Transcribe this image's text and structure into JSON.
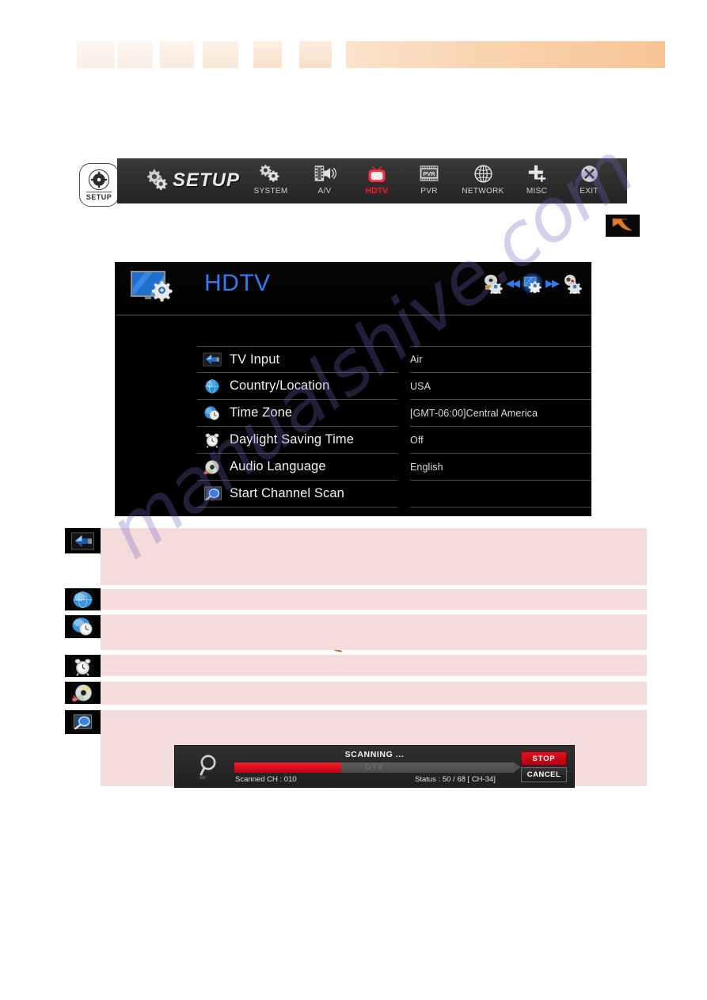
{
  "top_band": {
    "redacted_words": [
      "",
      "",
      "",
      "",
      "",
      ""
    ],
    "redacted_bar": ""
  },
  "setup_badge": {
    "label": "SETUP",
    "icon": "gear-icon"
  },
  "menubar": {
    "brand_label": "SETUP",
    "brand_icon": "double-gear-icon",
    "items": [
      {
        "label": "SYSTEM",
        "icon": "double-gear-icon",
        "active": false
      },
      {
        "label": "A/V",
        "icon": "film-speaker-icon",
        "active": false
      },
      {
        "label": "HDTV",
        "icon": "television-icon",
        "active": true
      },
      {
        "label": "PVR",
        "icon": "film-pvr-icon",
        "active": false
      },
      {
        "label": "NETWORK",
        "icon": "globe-icon",
        "active": false
      },
      {
        "label": "MISC",
        "icon": "plus-icon",
        "active": false
      },
      {
        "label": "EXIT",
        "icon": "close-x-icon",
        "active": false
      }
    ],
    "active_color": "#ff2b3c",
    "background": "#2e2e2e"
  },
  "cursor": {
    "icon": "orange-curved-arrow-icon",
    "color": "#e07b2e"
  },
  "panel": {
    "title": "HDTV",
    "title_color": "#2f7cf6",
    "icon": "monitor-gear-icon",
    "nav": {
      "prev_icon": "prev-chevrons-icon",
      "next_icon": "next-chevrons-icon",
      "left_icon": "disc-gear-icon",
      "center_icon": "monitor-gear-icon",
      "right_icon": "camera-gear-icon"
    },
    "settings": [
      {
        "icon": "tv-input-arrow-icon",
        "label": "TV Input",
        "value": "Air"
      },
      {
        "icon": "globe-icon",
        "label": "Country/Location",
        "value": "USA"
      },
      {
        "icon": "globe-clock-icon",
        "label": "Time Zone",
        "value": "[GMT-06:00]Central America"
      },
      {
        "icon": "alarm-clock-icon",
        "label": "Daylight Saving Time",
        "value": "Off"
      },
      {
        "icon": "audio-disc-icon",
        "label": "Audio Language",
        "value": "English"
      },
      {
        "icon": "scan-magnifier-icon",
        "label": "Start Channel Scan",
        "value": ""
      }
    ]
  },
  "descriptions": [
    {
      "icon": "tv-input-arrow-icon",
      "text": ""
    },
    {
      "icon": "globe-icon",
      "text": ""
    },
    {
      "icon": "globe-clock-icon",
      "text": ""
    },
    {
      "icon": "alarm-clock-icon",
      "text": ""
    },
    {
      "icon": "audio-disc-icon",
      "text": ""
    },
    {
      "icon": "scan-magnifier-icon",
      "text": ""
    }
  ],
  "scan_dialog": {
    "icon": "magnifier-icon",
    "title": "SCANNING ...",
    "bar_label": "DTV",
    "progress_percent": 38,
    "scanned_text": "Scanned CH : 010",
    "status_text": "Status : 50 / 68 [ CH-34]",
    "stop_label": "STOP",
    "cancel_label": "CANCEL",
    "stop_color": "#d4111f"
  },
  "watermark": {
    "text": "manualshive.com"
  }
}
